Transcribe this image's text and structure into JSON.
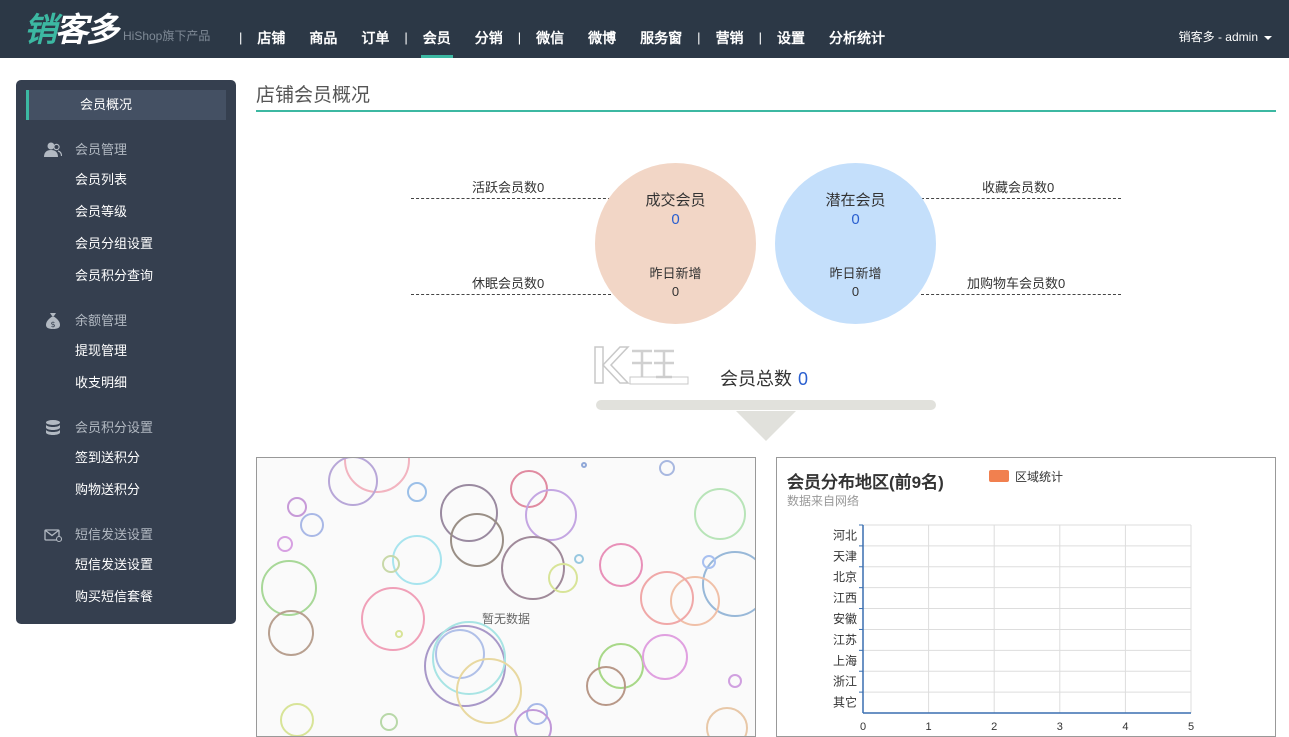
{
  "header": {
    "logo_main_a": "销",
    "logo_main_b": "客多",
    "logo_sub": "HiShop旗下产品",
    "nav": [
      {
        "label": "店铺"
      },
      {
        "label": "商品"
      },
      {
        "label": "订单"
      },
      {
        "label": "会员"
      },
      {
        "label": "分销"
      },
      {
        "label": "微信"
      },
      {
        "label": "微博"
      },
      {
        "label": "服务窗"
      },
      {
        "label": "营销"
      },
      {
        "label": "设置"
      },
      {
        "label": "分析统计"
      }
    ],
    "nav_active": "会员",
    "user": "销客多 - admin"
  },
  "sidebar": {
    "active": "会员概况",
    "groups": [
      {
        "label": "会员管理",
        "icon": "users-icon",
        "items": [
          "会员列表",
          "会员等级",
          "会员分组设置",
          "会员积分查询"
        ]
      },
      {
        "label": "余额管理",
        "icon": "money-bag-icon",
        "items": [
          "提现管理",
          "收支明细"
        ]
      },
      {
        "label": "会员积分设置",
        "icon": "database-icon",
        "items": [
          "签到送积分",
          "购物送积分"
        ]
      },
      {
        "label": "短信发送设置",
        "icon": "envelope-icon",
        "items": [
          "短信发送设置",
          "购买短信套餐"
        ]
      }
    ]
  },
  "main": {
    "title": "店铺会员概况",
    "deal": {
      "title": "成交会员",
      "value": "0",
      "sub": "昨日新增",
      "subvalue": "0"
    },
    "potential": {
      "title": "潜在会员",
      "value": "0",
      "sub": "昨日新增",
      "subvalue": "0"
    },
    "labels": {
      "active": "活跃会员数0",
      "dormant": "休眠会员数0",
      "favorite": "收藏会员数0",
      "cart": "加购物车会员数0"
    },
    "total_label": "会员总数",
    "total_value": "0",
    "left_panel_text": "暂无数据"
  },
  "chart_data": {
    "type": "bar",
    "orientation": "horizontal",
    "title": "会员分布地区(前9名)",
    "subtitle": "数据来自网络",
    "categories": [
      "河北",
      "天津",
      "北京",
      "江西",
      "安徽",
      "江苏",
      "上海",
      "浙江",
      "其它"
    ],
    "series": [
      {
        "name": "区域统计",
        "values": [
          0,
          0,
          0,
          0,
          0,
          0,
          0,
          0,
          0
        ],
        "color": "#f1804f"
      }
    ],
    "xlim": [
      0,
      5
    ],
    "xticks": [
      "0",
      "1",
      "2",
      "3",
      "4",
      "5"
    ],
    "grid": true,
    "legend": "top"
  }
}
